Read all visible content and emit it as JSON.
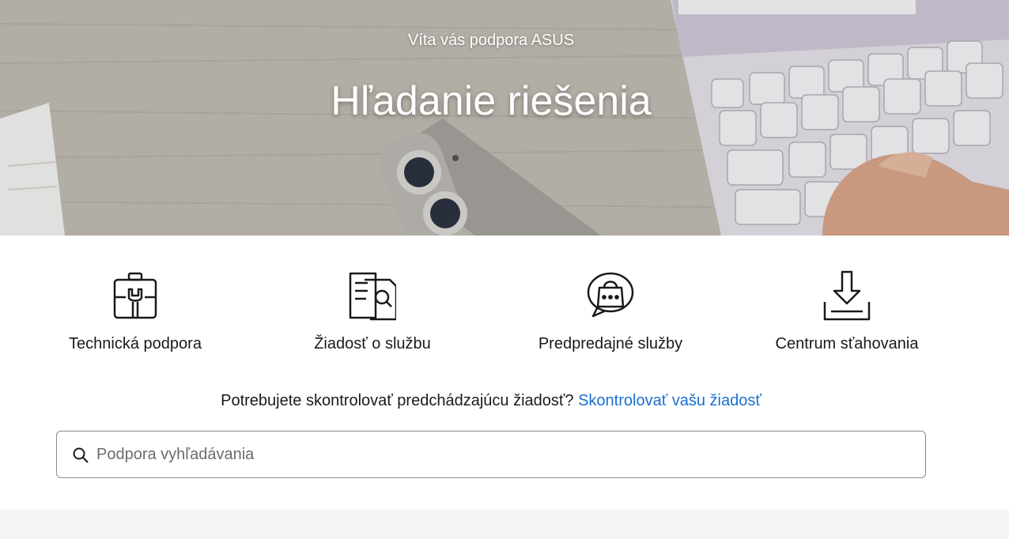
{
  "hero": {
    "subtitle": "Víta vás podpora ASUS",
    "title": "Hľadanie riešenia"
  },
  "categories": [
    {
      "label": "Technická podpora",
      "icon": "toolbox-wrench-icon"
    },
    {
      "label": "Žiadosť o službu",
      "icon": "document-search-icon"
    },
    {
      "label": "Predpredajné služby",
      "icon": "chat-bag-icon"
    },
    {
      "label": "Centrum sťahovania",
      "icon": "download-tray-icon"
    }
  ],
  "check": {
    "text": "Potrebujete skontrolovať predchádzajúcu žiadosť?",
    "link": "Skontrolovať vašu žiadosť"
  },
  "search": {
    "placeholder": "Podpora vyhľadávania",
    "value": ""
  },
  "colors": {
    "link": "#1a6fd1",
    "text": "#1a1a1a",
    "border": "#8a8a8a",
    "footer_band": "#f4f4f4"
  }
}
